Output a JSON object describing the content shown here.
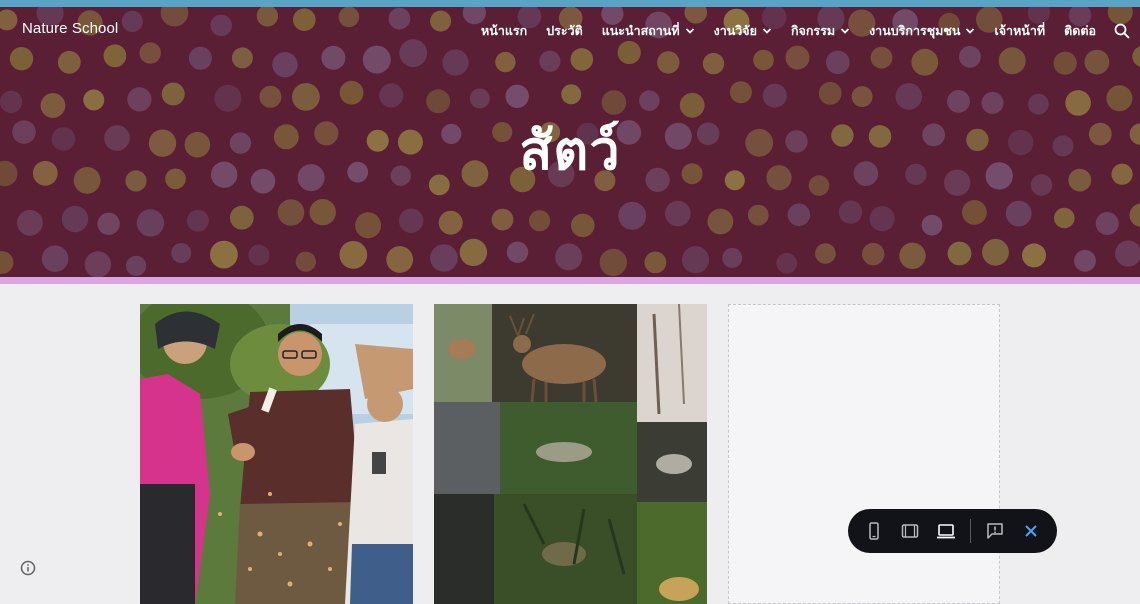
{
  "site": {
    "title": "Nature School"
  },
  "nav": {
    "items": [
      {
        "label": "หน้าแรก",
        "dropdown": false
      },
      {
        "label": "ประวัติ",
        "dropdown": false
      },
      {
        "label": "แนะนำสถานที่",
        "dropdown": true
      },
      {
        "label": "งานวิจัย",
        "dropdown": true
      },
      {
        "label": "กิจกรรม",
        "dropdown": true
      },
      {
        "label": "งานบริการชุมชน",
        "dropdown": true
      },
      {
        "label": "เจ้าหน้าที่",
        "dropdown": false
      },
      {
        "label": "ติดต่อ",
        "dropdown": false
      }
    ],
    "search_icon": "search-icon"
  },
  "hero": {
    "title": "สัตว์",
    "background_color": "#5b1f35",
    "divider_color": "#dba5e3"
  },
  "cards": [
    {
      "name": "people-photo",
      "description_icon": "photo"
    },
    {
      "name": "wildlife-collage",
      "description_icon": "photo"
    },
    {
      "name": "empty-placeholder",
      "description_icon": "none"
    }
  ],
  "preview_toolbar": {
    "buttons": [
      "phone-icon",
      "tablet-icon",
      "laptop-icon",
      "feedback-icon",
      "close-icon"
    ],
    "active": "laptop-icon",
    "accent": "#4aa3f0"
  },
  "footer": {
    "info_icon": "info-icon"
  }
}
